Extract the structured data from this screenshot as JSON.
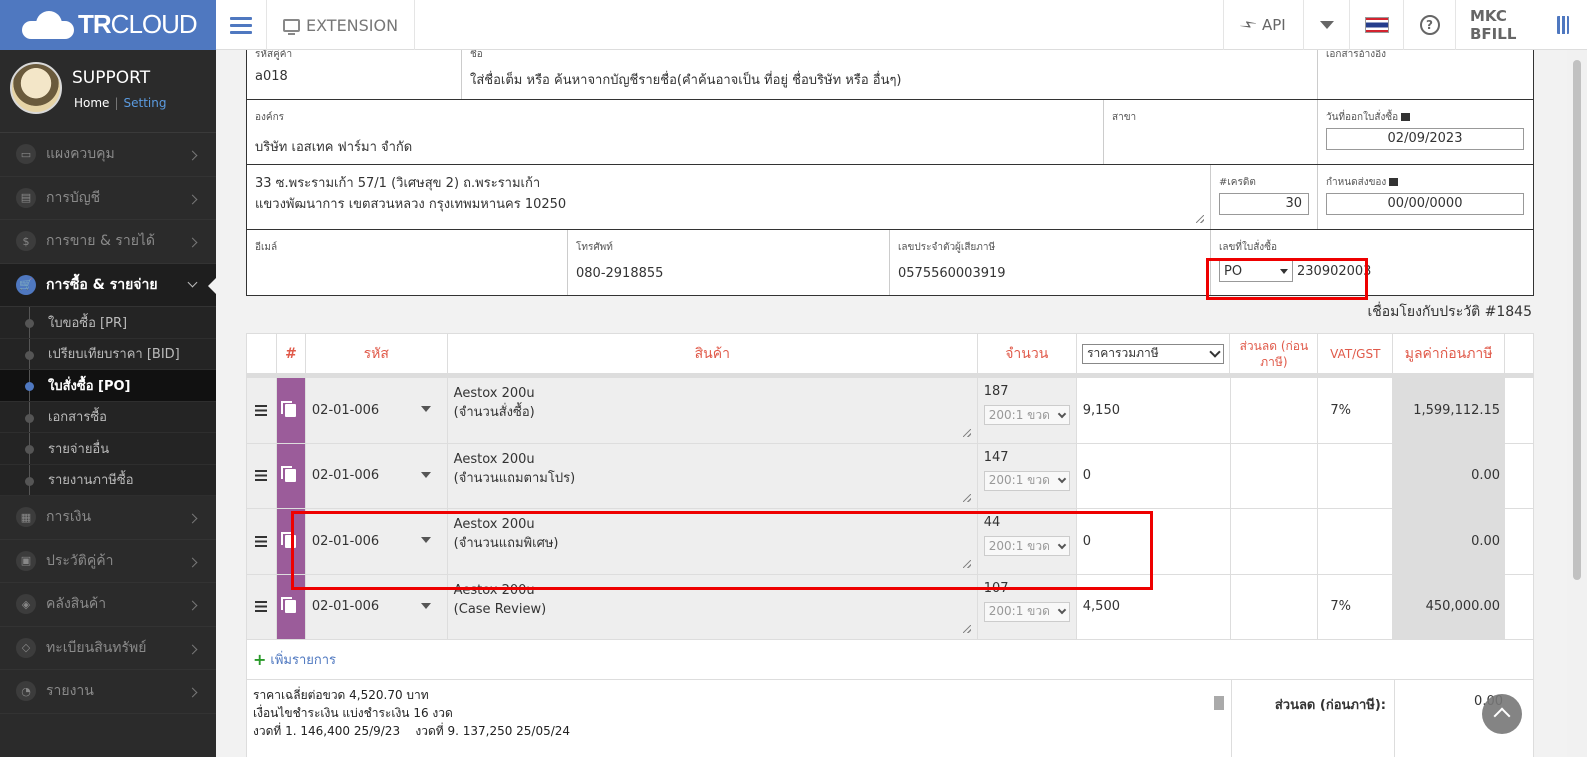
{
  "app": {
    "brand_bold": "TR",
    "brand_rest": "CLOUD",
    "extension_label": "EXTENSION",
    "api_label": "API",
    "user_label": "MKC BFILL"
  },
  "profile": {
    "name": "SUPPORT",
    "home_label": "Home",
    "separator": "|",
    "setting_label": "Setting"
  },
  "menu": [
    {
      "label": "แผงควบคุม"
    },
    {
      "label": "การบัญชี"
    },
    {
      "label": "การขาย & รายได้"
    },
    {
      "label": "การซื้อ & รายจ่าย"
    },
    {
      "label": "การเงิน"
    },
    {
      "label": "ประวัติคู่ค้า"
    },
    {
      "label": "คลังสินค้า"
    },
    {
      "label": "ทะเบียนสินทรัพย์"
    },
    {
      "label": "รายงาน"
    }
  ],
  "submenu": [
    {
      "label": "ใบขอซื้อ [PR]"
    },
    {
      "label": "เปรียบเทียบราคา [BID]"
    },
    {
      "label": "ใบสั่งซื้อ [PO]"
    },
    {
      "label": "เอกสารซื้อ"
    },
    {
      "label": "รายจ่ายอื่น"
    },
    {
      "label": "รายงานภาษีซื้อ"
    }
  ],
  "form": {
    "code_label": "รหัสคู่ค้า",
    "code_value": "a018",
    "name_label": "ชื่อ",
    "name_value": "ใส่ชื่อเต็ม หรือ ค้นหาจากบัญชีรายชื่อ(คำค้นอาจเป็น ที่อยู่ ชื่อบริษัท หรือ อื่นๆ)",
    "ref_label": "เอกสารอ้างอิง",
    "org_label": "องค์กร",
    "org_value": "บริษัท เอสเทค ฟาร์มา จำกัด",
    "branch_label": "สาขา",
    "po_date_label": "วันที่ออกใบสั่งซื้อ",
    "po_date_value": "02/09/2023",
    "address_line1": "33 ซ.พระรามเก้า 57/1 (วิเศษสุข 2) ถ.พระรามเก้า",
    "address_line2": "แขวงพัฒนาการ เขตสวนหลวง กรุงเทพมหานคร 10250",
    "credit_label": "#เครดิต",
    "credit_value": "30",
    "delivery_label": "กำหนดส่งของ",
    "delivery_value": "00/00/0000",
    "email_label": "อีเมล์",
    "phone_label": "โทรศัพท์",
    "phone_value": "080-2918855",
    "taxid_label": "เลขประจำตัวผู้เสียภาษี",
    "taxid_value": "0575560003919",
    "po_no_label": "เลขที่ใบสั่งซื้อ",
    "po_prefix": "PO",
    "po_no_value": "230902003"
  },
  "linked_text": "เชื่อมโยงกับประวัติ #1845",
  "table": {
    "headers": {
      "hash": "#",
      "code": "รหัส",
      "product": "สินค้า",
      "qty": "จำนวน",
      "price_mode": "ราคารวมภาษี",
      "discount": "ส่วนลด (ก่อนภาษี)",
      "vat": "VAT/GST",
      "total": "มูลค่าก่อนภาษี"
    },
    "rows": [
      {
        "code": "02-01-006",
        "name1": "Aestox 200u",
        "name2": "(จำนวนสั่งซื้อ)",
        "qty": "187",
        "unit": "200:1 ขวด",
        "price": "9,150",
        "vat": "7%",
        "total": "1,599,112.15"
      },
      {
        "code": "02-01-006",
        "name1": "Aestox 200u",
        "name2": "(จำนวนแถมตามโปร)",
        "qty": "147",
        "unit": "200:1 ขวด",
        "price": "0",
        "vat": "",
        "total": "0.00"
      },
      {
        "code": "02-01-006",
        "name1": "Aestox 200u",
        "name2": "(จำนวนแถมพิเศษ)",
        "qty": "44",
        "unit": "200:1 ขวด",
        "price": "0",
        "vat": "",
        "total": "0.00"
      },
      {
        "code": "02-01-006",
        "name1": "Aestox 200u",
        "name2": "(Case Review)",
        "qty": "107",
        "unit": "200:1 ขวด",
        "price": "4,500",
        "vat": "7%",
        "total": "450,000.00"
      }
    ],
    "add_label": "เพิ่มรายการ"
  },
  "summary": {
    "note1": "ราคาเฉลี่ยต่อขวด 4,520.70 บาท",
    "note2": "เงื่อนไขชำระเงิน แบ่งชำระเงิน 16 งวด",
    "note3a": "งวดที่ 1. 146,400  25/9/23",
    "note3b": "งวดที่ 9. 137,250  25/05/24",
    "discount_label": "ส่วนลด (ก่อนภาษี):",
    "discount_value": "0.00"
  }
}
